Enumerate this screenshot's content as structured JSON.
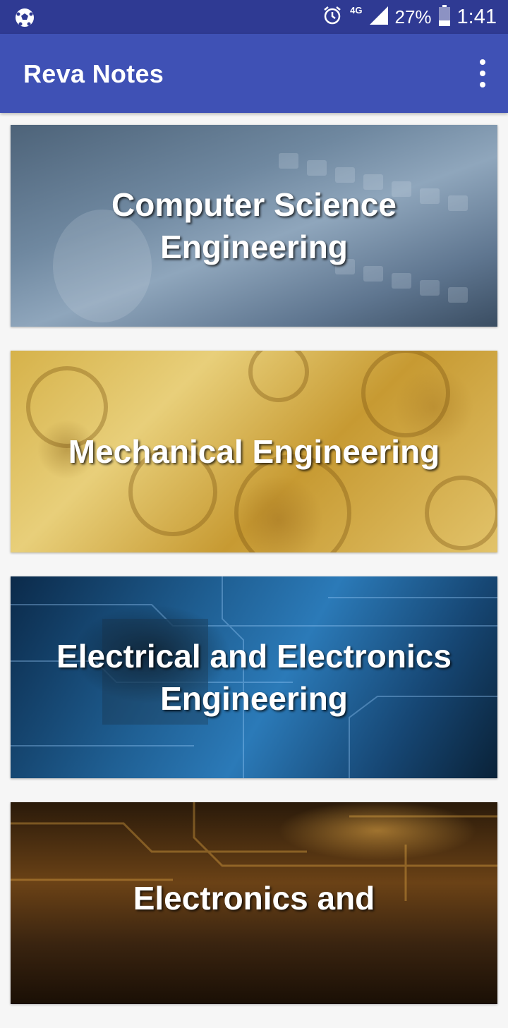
{
  "status_bar": {
    "network": "4G",
    "battery": "27%",
    "time": "1:41",
    "icons": [
      "soccer-ball-icon",
      "alarm-icon",
      "signal-icon",
      "battery-icon"
    ]
  },
  "app_bar": {
    "title": "Reva Notes",
    "overflow_icon": "more-vert-icon"
  },
  "courses": [
    {
      "title": "Computer Science Engineering"
    },
    {
      "title": "Mechanical Engineering"
    },
    {
      "title": "Electrical and Electronics Engineering"
    },
    {
      "title": "Electronics and"
    }
  ],
  "colors": {
    "status_bar": "#2f3a93",
    "app_bar": "#3f51b5",
    "background": "#f6f6f6"
  }
}
